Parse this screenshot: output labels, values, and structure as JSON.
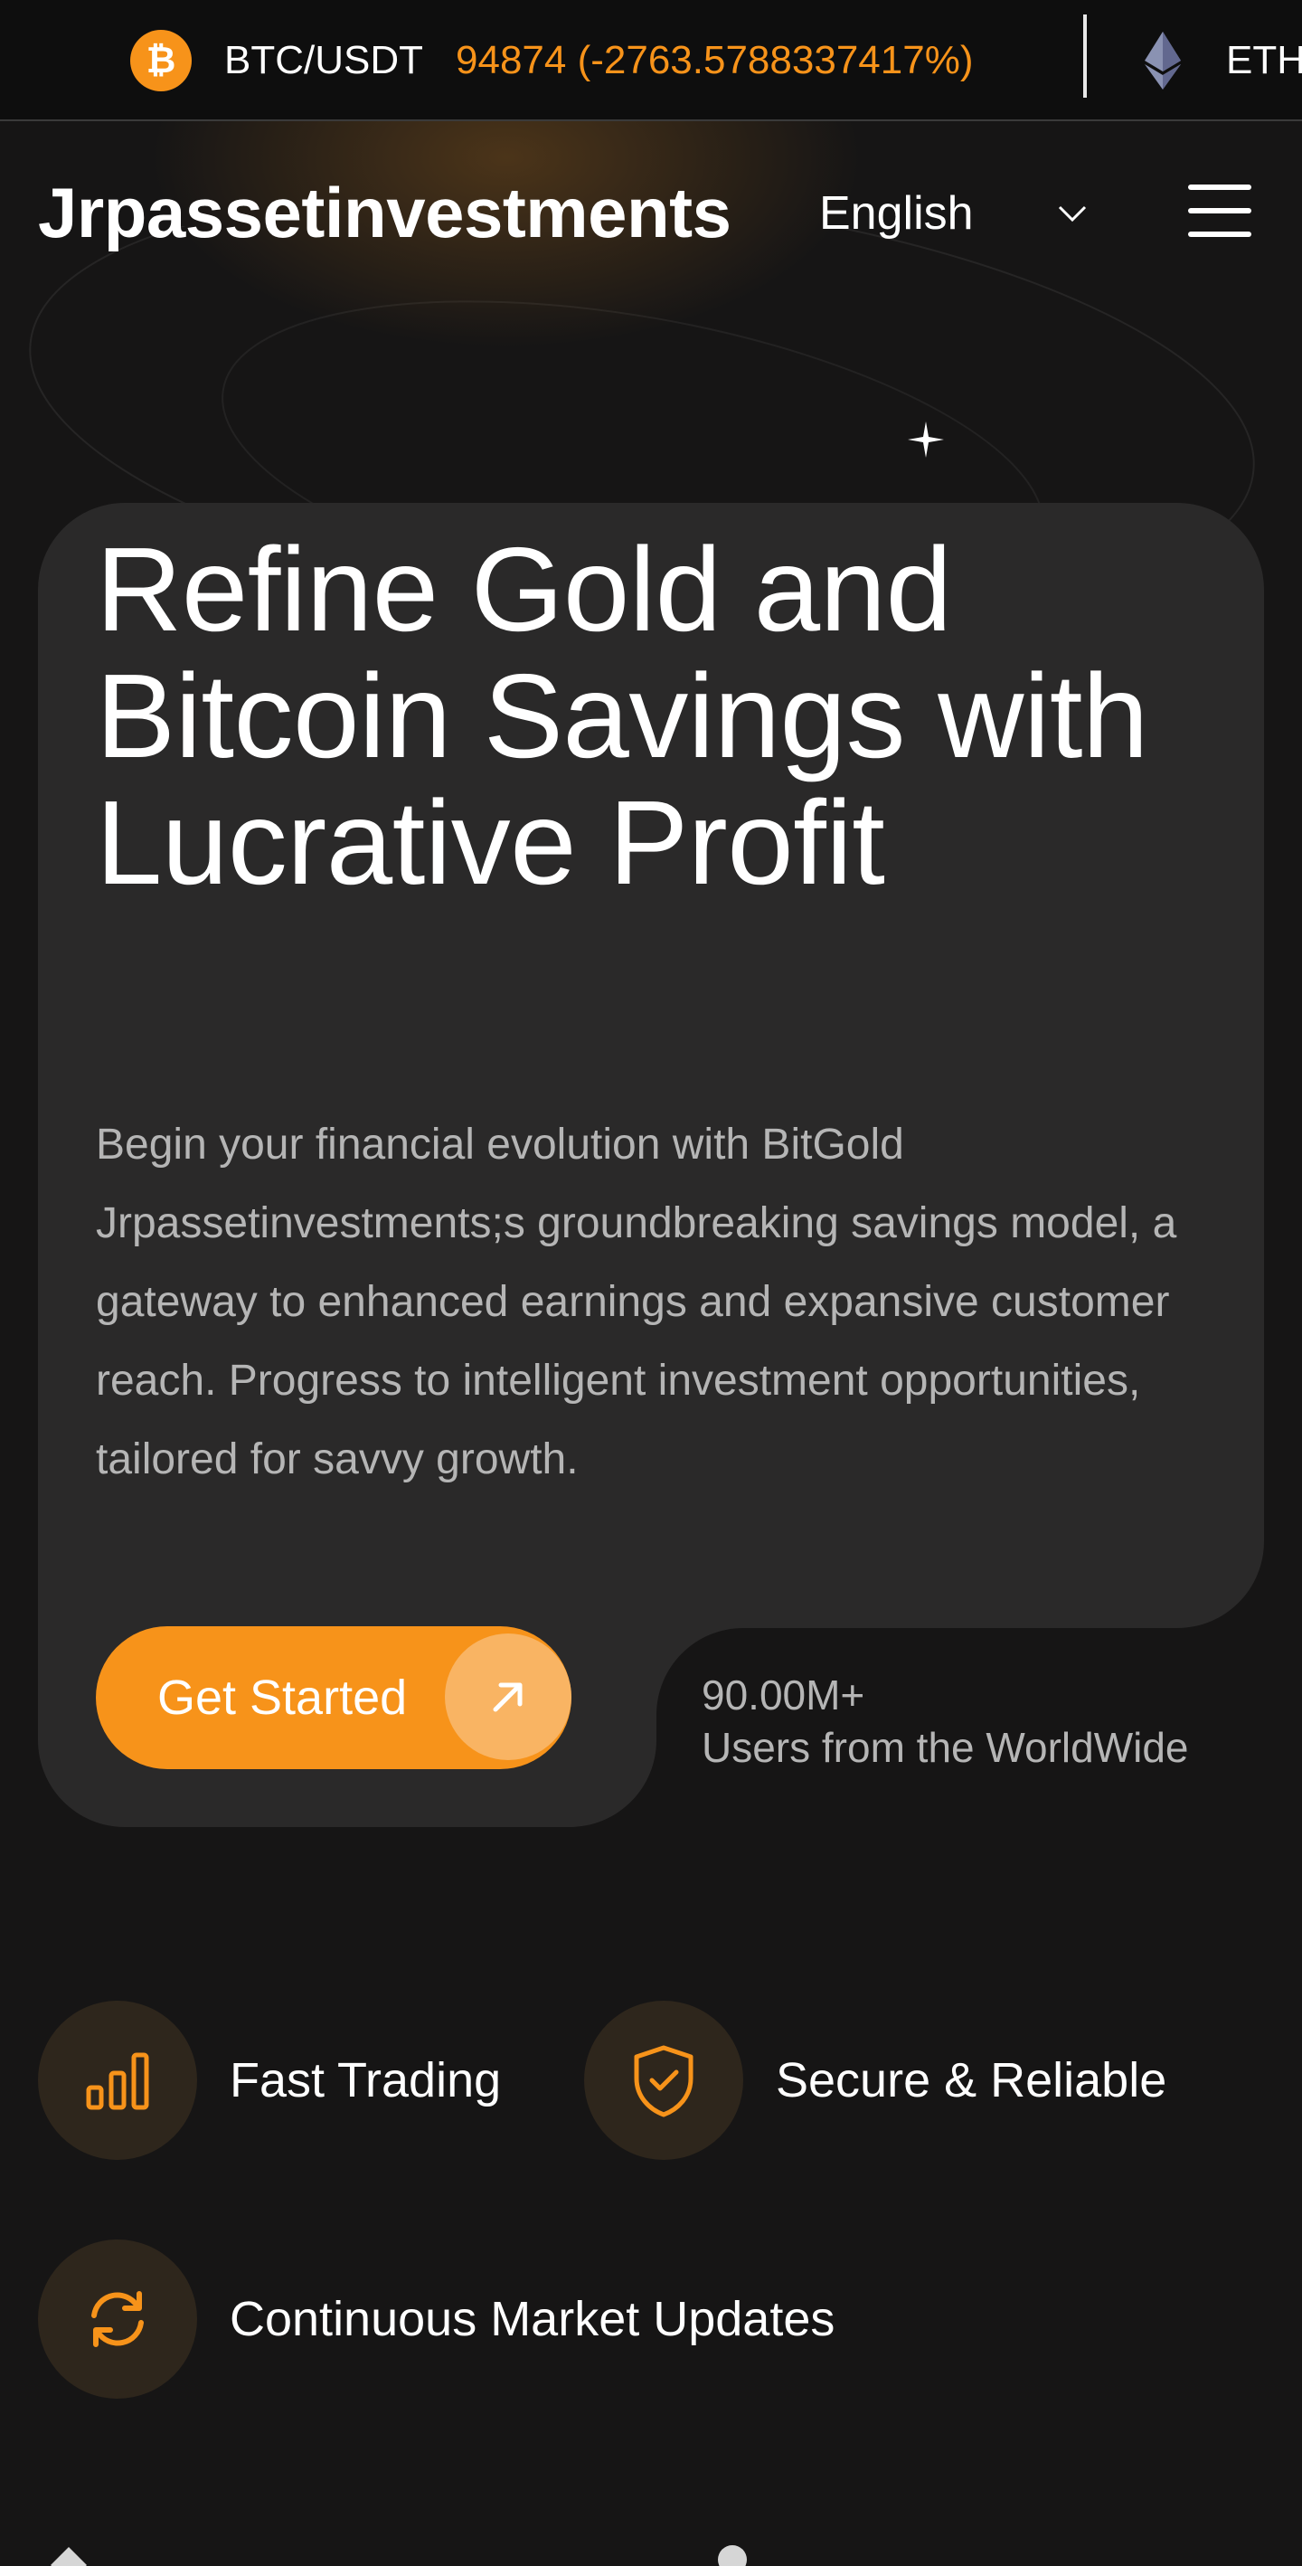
{
  "ticker": {
    "items": [
      {
        "symbol": "BTC/USDT",
        "price_text": "94874 (-2763.5788337417%)",
        "icon": "bitcoin-icon",
        "color": "#f7931a"
      },
      {
        "symbol": "ETH",
        "icon": "ethereum-icon",
        "color": "#627eea"
      }
    ]
  },
  "header": {
    "brand": "Jrpassetinvestments",
    "language": "English",
    "icons": {
      "language_toggle": "chevron-down-icon",
      "menu": "hamburger-menu-icon"
    }
  },
  "hero": {
    "title": "Refine Gold and Bitcoin Savings with Lucrative Profit",
    "description": "Begin your financial evolution with BitGold Jrpassetinvestments;s groundbreaking savings model, a gateway to enhanced earnings and expansive customer reach. Progress to intelligent investment opportunities, tailored for savvy growth.",
    "cta_label": "Get Started",
    "cta_icon": "arrow-up-right-icon",
    "users_count": "90.00M+",
    "users_label": "Users from the WorldWide"
  },
  "features": [
    {
      "label": "Fast Trading",
      "icon": "bar-chart-icon"
    },
    {
      "label": "Secure & Reliable",
      "icon": "shield-check-icon"
    },
    {
      "label": "Continuous Market Updates",
      "icon": "refresh-icon"
    }
  ],
  "colors": {
    "accent": "#f7931a",
    "accent_light": "#f9b463",
    "background": "#161515",
    "card": "#2a2929",
    "icon_bg": "#2e261c"
  }
}
